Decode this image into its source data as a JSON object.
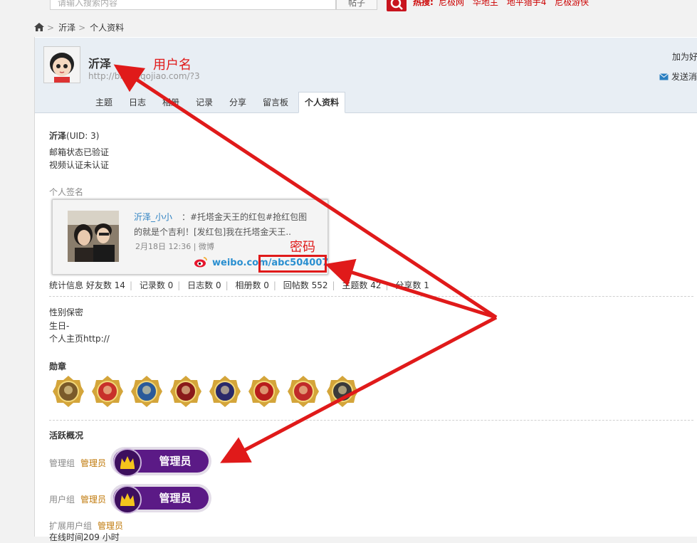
{
  "topbar": {
    "search_placeholder": "请输入搜索内容",
    "search_type": "帖子",
    "hot_label": "热搜:",
    "hot_links": [
      "尼极网",
      "华地主",
      "地平猎手4",
      "尼极游侠"
    ]
  },
  "breadcrumb": {
    "home_icon": "home-icon",
    "items": [
      "沂泽",
      "个人资料"
    ]
  },
  "profile": {
    "username": "沂泽",
    "url": "http://bbs.niqojiao.com/?3",
    "add_friend": "加为好",
    "send_message": "发送消",
    "tabs": [
      "主题",
      "日志",
      "相册",
      "记录",
      "分享",
      "留言板",
      "个人资料"
    ],
    "active_tab": "个人资料"
  },
  "info": {
    "name": "沂泽",
    "uid": "(UID: 3)",
    "email_status": "邮箱状态已验证",
    "video_status": "视频认证未认证",
    "signature_label": "个人签名"
  },
  "signature": {
    "author": "沂泽_小小",
    "line1": "：#托塔金天王的红包#抢红包图",
    "line2": "的就是个吉利！[发红包]我在托塔金天王..",
    "meta": "2月18日 12:36 | 微博",
    "weibo_link": "weibo.com/abc504007"
  },
  "stats": {
    "label": "统计信息",
    "items": [
      "好友数 14",
      "记录数 0",
      "日志数 0",
      "相册数 0",
      "回帖数 552",
      "主题数 42",
      "分享数 1"
    ]
  },
  "personal": {
    "gender": "性别保密",
    "birthday": "生日-",
    "homepage": "个人主页http://"
  },
  "medals": {
    "title": "勋章",
    "count": 8,
    "colors": [
      "#7a5a2a",
      "#c8302a",
      "#2a5a9a",
      "#8a1a1a",
      "#2a2a6a",
      "#b81c1c",
      "#c02a2a",
      "#3a3a3a"
    ]
  },
  "activity": {
    "title": "活跃概况",
    "admin_group_label": "管理组",
    "admin_group_value": "管理员",
    "user_group_label": "用户组",
    "user_group_value": "管理员",
    "ext_group_label": "扩展用户组",
    "ext_group_value": "管理员",
    "online_time": "在线时间209 小时",
    "pill_label": "管理员",
    "pill_icon": "crown-icon"
  },
  "annotations": {
    "username_note": "用户名",
    "password_note": "密码"
  },
  "colors": {
    "accent_red": "#e01a1a",
    "link_blue": "#2a7fc1",
    "group_orange": "#c0790a",
    "pill_purple": "#5b1a86"
  }
}
